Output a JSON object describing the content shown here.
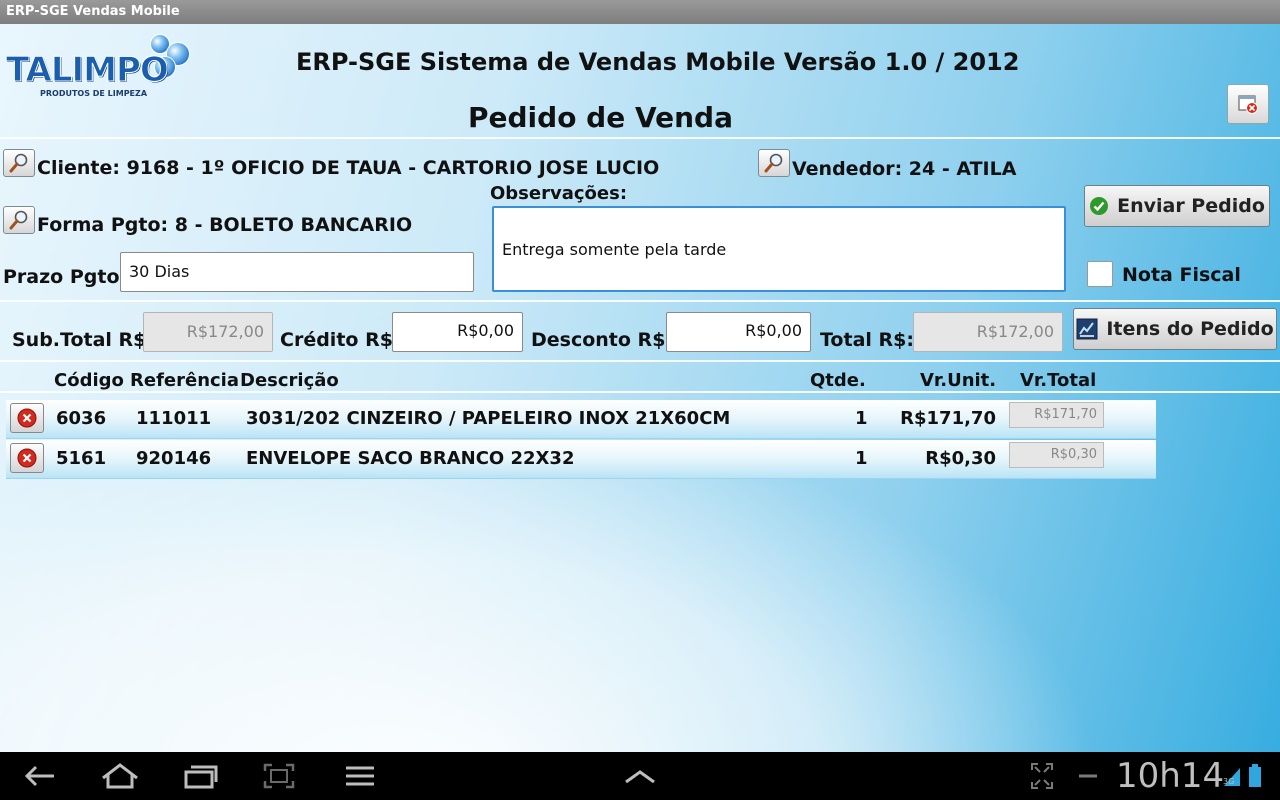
{
  "window": {
    "title": "ERP-SGE Vendas Mobile"
  },
  "brand": {
    "logo_text": "TALIMPO",
    "logo_sub": "PRODUTOS DE LIMPEZA"
  },
  "header": {
    "app_title": "ERP-SGE Sistema de Vendas Mobile Versão 1.0 / 2012",
    "page_title": "Pedido de Venda"
  },
  "form": {
    "cliente": "Cliente: 9168 - 1º OFICIO DE TAUA - CARTORIO JOSE LUCIO",
    "vendedor": "Vendedor: 24 - ATILA",
    "forma_pgto": "Forma Pgto: 8 - BOLETO BANCARIO",
    "prazo_label": "Prazo Pgto:",
    "prazo_value": "30 Dias",
    "obs_label": "Observações:",
    "obs_value": "Entrega somente pela tarde",
    "enviar_label": "Enviar Pedido",
    "nota_fiscal_label": "Nota Fiscal",
    "nota_fiscal_checked": false
  },
  "totals": {
    "subtotal_label": "Sub.Total R$:",
    "subtotal_value": "R$172,00",
    "credito_label": "Crédito R$:",
    "credito_value": "R$0,00",
    "desconto_label": "Desconto R$:",
    "desconto_value": "R$0,00",
    "total_label": "Total R$:",
    "total_value": "R$172,00",
    "itens_label": "Itens do Pedido"
  },
  "table": {
    "headers": {
      "codigo": "Código",
      "referencia": "Referência",
      "descricao": "Descrição",
      "qtde": "Qtde.",
      "vr_unit": "Vr.Unit.",
      "vr_total": "Vr.Total"
    },
    "rows": [
      {
        "codigo": "6036",
        "referencia": "111011",
        "descricao": "3031/202 CINZEIRO / PAPELEIRO INOX 21X60CM",
        "qtde": "1",
        "vr_unit": "R$171,70",
        "vr_total": "R$171,70"
      },
      {
        "codigo": "5161",
        "referencia": "920146",
        "descricao": "ENVELOPE SACO BRANCO 22X32",
        "qtde": "1",
        "vr_unit": "R$0,30",
        "vr_total": "R$0,30"
      }
    ]
  },
  "system_bar": {
    "clock": "10h14",
    "network": "3G"
  },
  "colors": {
    "accent": "#37ade0",
    "obs_border": "#3a8fd8",
    "remove_red": "#d42a1e",
    "check_green": "#2d9a2d"
  }
}
